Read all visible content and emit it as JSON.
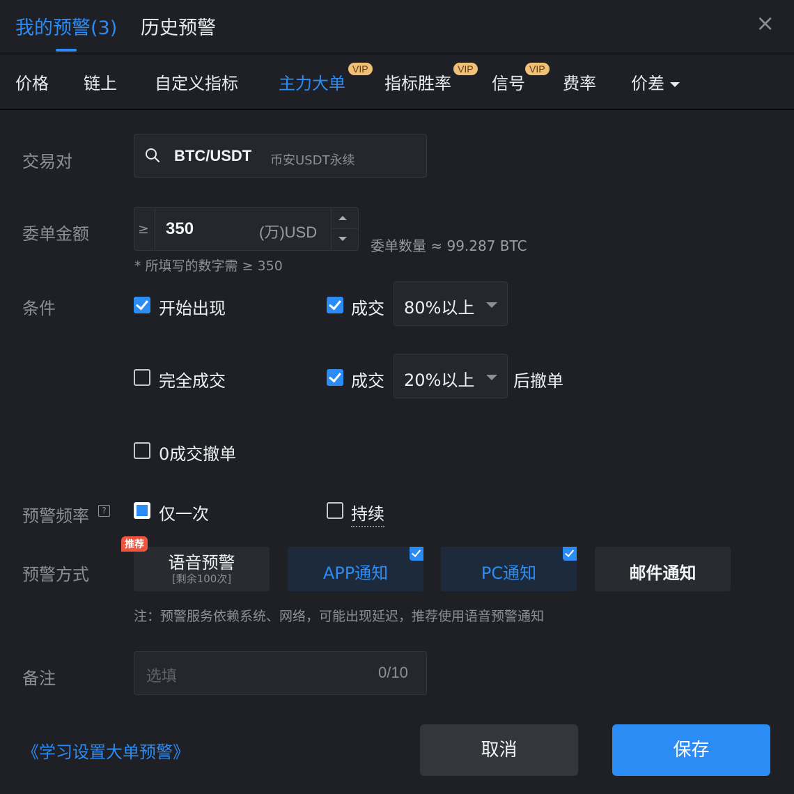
{
  "header": {
    "tabs": [
      {
        "label": "我的预警(3)",
        "active": true
      },
      {
        "label": "历史预警",
        "active": false
      }
    ],
    "close_icon": "×"
  },
  "categories": {
    "items": [
      {
        "label": "价格"
      },
      {
        "label": "链上"
      },
      {
        "label": "自定义指标"
      },
      {
        "label": "主力大单",
        "vip": "VIP",
        "active": true
      },
      {
        "label": "指标胜率",
        "vip": "VIP"
      },
      {
        "label": "信号",
        "vip": "VIP"
      },
      {
        "label": "费率"
      },
      {
        "label": "价差"
      }
    ]
  },
  "form": {
    "pair": {
      "label": "交易对",
      "symbol": "BTC/USDT",
      "market": "币安USDT永续"
    },
    "amount": {
      "label": "委单金额",
      "prefix": "≥",
      "value": "350",
      "unit": "(万)USD",
      "quantity": "委单数量 ≈ 99.287 BTC",
      "hint": "* 所填写的数字需 ≥ 350"
    },
    "conditions": {
      "label": "条件",
      "items": [
        {
          "label": "开始出现",
          "checked": true
        },
        {
          "label": "完全成交",
          "checked": false
        },
        {
          "label": "0成交撤单",
          "checked": false
        }
      ],
      "deal1": {
        "label": "成交",
        "checked": true,
        "select": "80%以上"
      },
      "deal2": {
        "label": "成交",
        "checked": true,
        "select": "20%以上",
        "suffix": "后撤单"
      }
    },
    "frequency": {
      "label": "预警频率",
      "help": "?",
      "options": [
        {
          "label": "仅一次",
          "selected": true
        },
        {
          "label": "持续",
          "selected": false
        }
      ]
    },
    "method": {
      "label": "预警方式",
      "badge": "推荐",
      "options": [
        {
          "label": "语音预警",
          "sub": "[剩余100次]",
          "selected": false
        },
        {
          "label": "APP通知",
          "selected": true
        },
        {
          "label": "PC通知",
          "selected": true
        },
        {
          "label": "邮件通知",
          "selected": false
        }
      ],
      "note": "注：预警服务依赖系统、网络，可能出现延迟，推荐使用语音预警通知"
    },
    "remark": {
      "label": "备注",
      "placeholder": "选填",
      "count": "0/10"
    }
  },
  "footer": {
    "learn_link": "《学习设置大单预警》",
    "cancel": "取消",
    "save": "保存"
  },
  "colors": {
    "accent": "#2b8cf5",
    "background": "#1f2025",
    "vip": "#f0c078",
    "badge": "#f0543c"
  }
}
